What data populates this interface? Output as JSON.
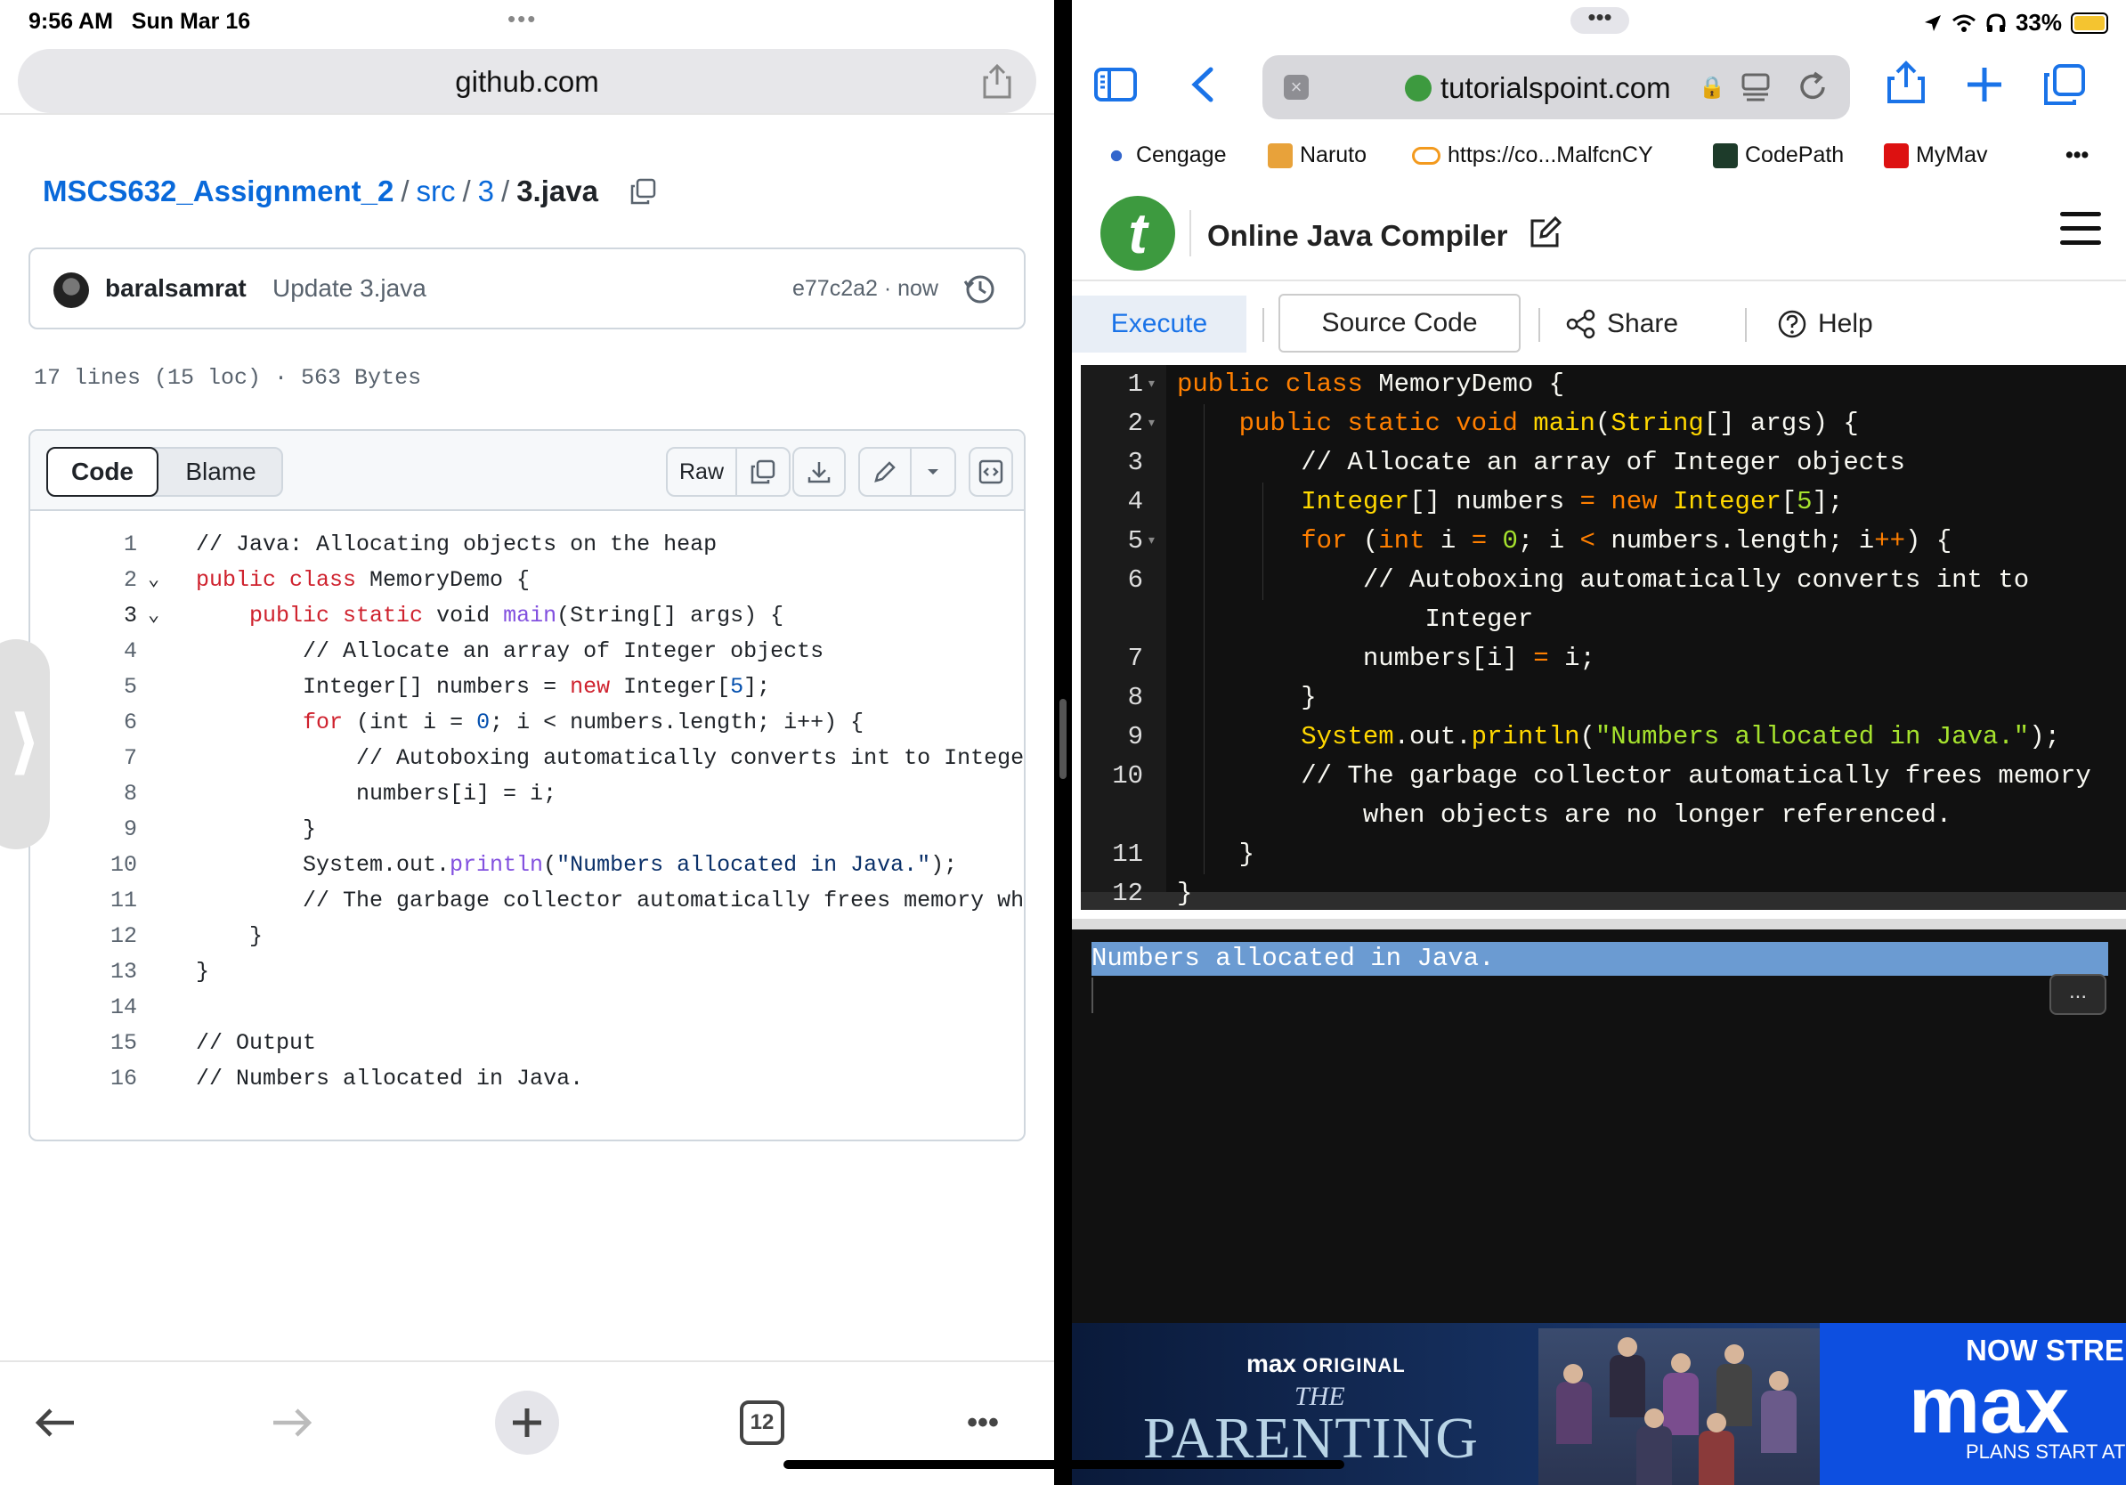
{
  "left": {
    "status": {
      "time": "9:56 AM",
      "date": "Sun Mar 16",
      "dots": "•••"
    },
    "address_bar": {
      "url": "github.com"
    },
    "breadcrumb": {
      "repo": "MSCS632_Assignment_2",
      "dir1": "src",
      "dir2": "3",
      "file": "3.java",
      "sep": "/"
    },
    "commit": {
      "author": "baralsamrat",
      "message": "Update 3.java",
      "sha": "e77c2a2",
      "time": "now",
      "meta": "e77c2a2 · now"
    },
    "file_info": "17 lines (15 loc) · 563 Bytes",
    "code_toolbar": {
      "code_tab": "Code",
      "blame_tab": "Blame",
      "raw": "Raw"
    },
    "code_lines": [
      {
        "n": "1",
        "text": "// Java: Allocating objects on the heap"
      },
      {
        "n": "2",
        "text": "public class MemoryDemo {"
      },
      {
        "n": "3",
        "text": "    public static void main(String[] args) {"
      },
      {
        "n": "4",
        "text": "        // Allocate an array of Integer objects"
      },
      {
        "n": "5",
        "text": "        Integer[] numbers = new Integer[5];"
      },
      {
        "n": "6",
        "text": "        for (int i = 0; i < numbers.length; i++) {"
      },
      {
        "n": "7",
        "text": "            // Autoboxing automatically converts int to Integer"
      },
      {
        "n": "8",
        "text": "            numbers[i] = i;"
      },
      {
        "n": "9",
        "text": "        }"
      },
      {
        "n": "10",
        "text": "        System.out.println(\"Numbers allocated in Java.\");"
      },
      {
        "n": "11",
        "text": "        // The garbage collector automatically frees memory whe"
      },
      {
        "n": "12",
        "text": "    }"
      },
      {
        "n": "13",
        "text": "}"
      },
      {
        "n": "14",
        "text": ""
      },
      {
        "n": "15",
        "text": "// Output"
      },
      {
        "n": "16",
        "text": "// Numbers allocated in Java."
      }
    ],
    "bottom_bar": {
      "tab_count": "12",
      "more": "•••"
    }
  },
  "right": {
    "status": {
      "dots": "•••",
      "battery": "33%"
    },
    "address_bar": {
      "url": "tutorialspoint.com"
    },
    "bookmarks": [
      "Cengage",
      "Naruto",
      "https://co...MalfcnCY",
      "CodePath",
      "MyMav"
    ],
    "bookmarks_more": "•••",
    "site": {
      "title": "Online Java Compiler"
    },
    "tabs": {
      "execute": "Execute",
      "source": "Source Code",
      "share": "Share",
      "help": "Help"
    },
    "editor_lines": [
      {
        "n": "1",
        "text": "public class MemoryDemo {"
      },
      {
        "n": "2",
        "text": "    public static void main(String[] args) {"
      },
      {
        "n": "3",
        "text": "        // Allocate an array of Integer objects"
      },
      {
        "n": "4",
        "text": "        Integer[] numbers = new Integer[5];"
      },
      {
        "n": "5",
        "text": "        for (int i = 0; i < numbers.length; i++) {"
      },
      {
        "n": "6",
        "text": "            // Autoboxing automatically converts int to"
      },
      {
        "n": "",
        "text": "                Integer"
      },
      {
        "n": "7",
        "text": "            numbers[i] = i;"
      },
      {
        "n": "8",
        "text": "        }"
      },
      {
        "n": "9",
        "text": "        System.out.println(\"Numbers allocated in Java.\");"
      },
      {
        "n": "10",
        "text": "        // The garbage collector automatically frees memory"
      },
      {
        "n": "",
        "text": "            when objects are no longer referenced."
      },
      {
        "n": "11",
        "text": "    }"
      },
      {
        "n": "12",
        "text": "}"
      }
    ],
    "output": {
      "text": "Numbers allocated in Java.",
      "more": "..."
    },
    "ad": {
      "brand_line": "max",
      "brand_original": "ORIGINAL",
      "show_the": "THE",
      "show_title": "PARENTING",
      "cta_now": "NOW STRE",
      "cta_brand": "max",
      "cta_plans": "PLANS START AT $"
    }
  }
}
